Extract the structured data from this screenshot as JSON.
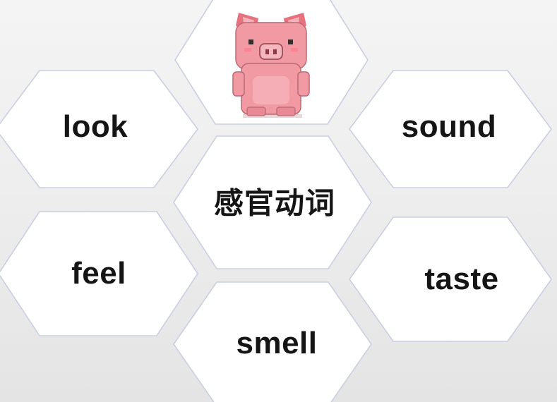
{
  "center": {
    "label": "感官动词"
  },
  "words": {
    "look": "look",
    "sound": "sound",
    "feel": "feel",
    "taste": "taste",
    "smell": "smell"
  },
  "image": {
    "icon": "pink-pig-pixel-icon"
  },
  "colors": {
    "hex_fill": "#ffffff",
    "hex_border": "#c9cfe0",
    "text": "#151515",
    "pig_body": "#f19aa4",
    "pig_ears": "#e8717f"
  }
}
